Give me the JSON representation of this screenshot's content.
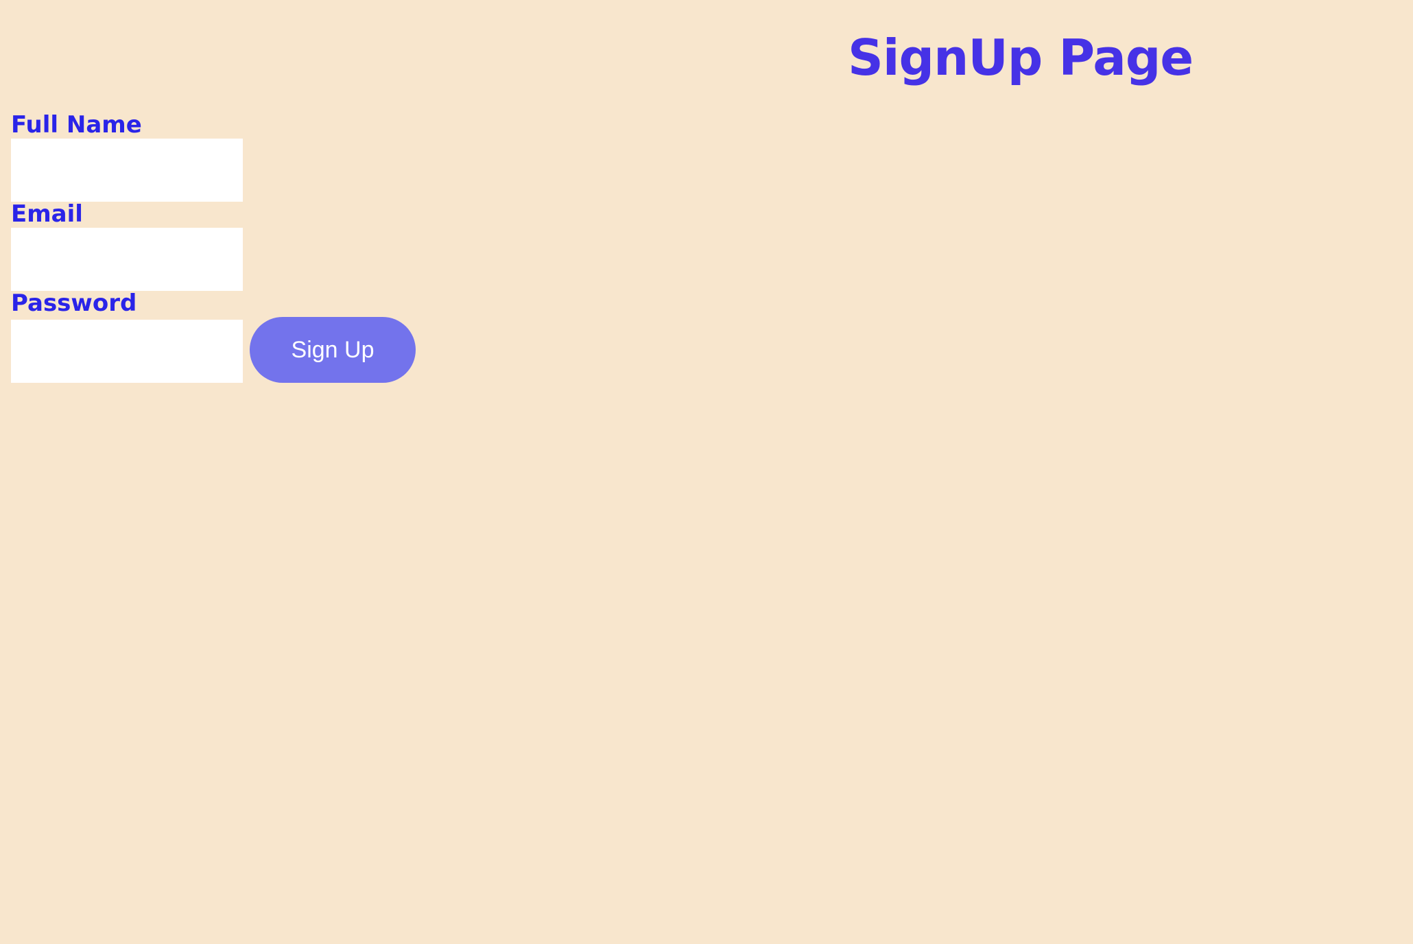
{
  "header": {
    "title": "SignUp Page"
  },
  "form": {
    "fullname": {
      "label": "Full Name",
      "value": "",
      "placeholder": ""
    },
    "email": {
      "label": "Email",
      "value": "",
      "placeholder": ""
    },
    "password": {
      "label": "Password",
      "value": "",
      "placeholder": ""
    },
    "submit_label": "Sign Up"
  },
  "colors": {
    "background": "#f8e6cd",
    "title": "#4632e6",
    "label": "#2a24e8",
    "button": "#7373ec",
    "button_text": "#ffffff",
    "input_background": "#ffffff"
  }
}
